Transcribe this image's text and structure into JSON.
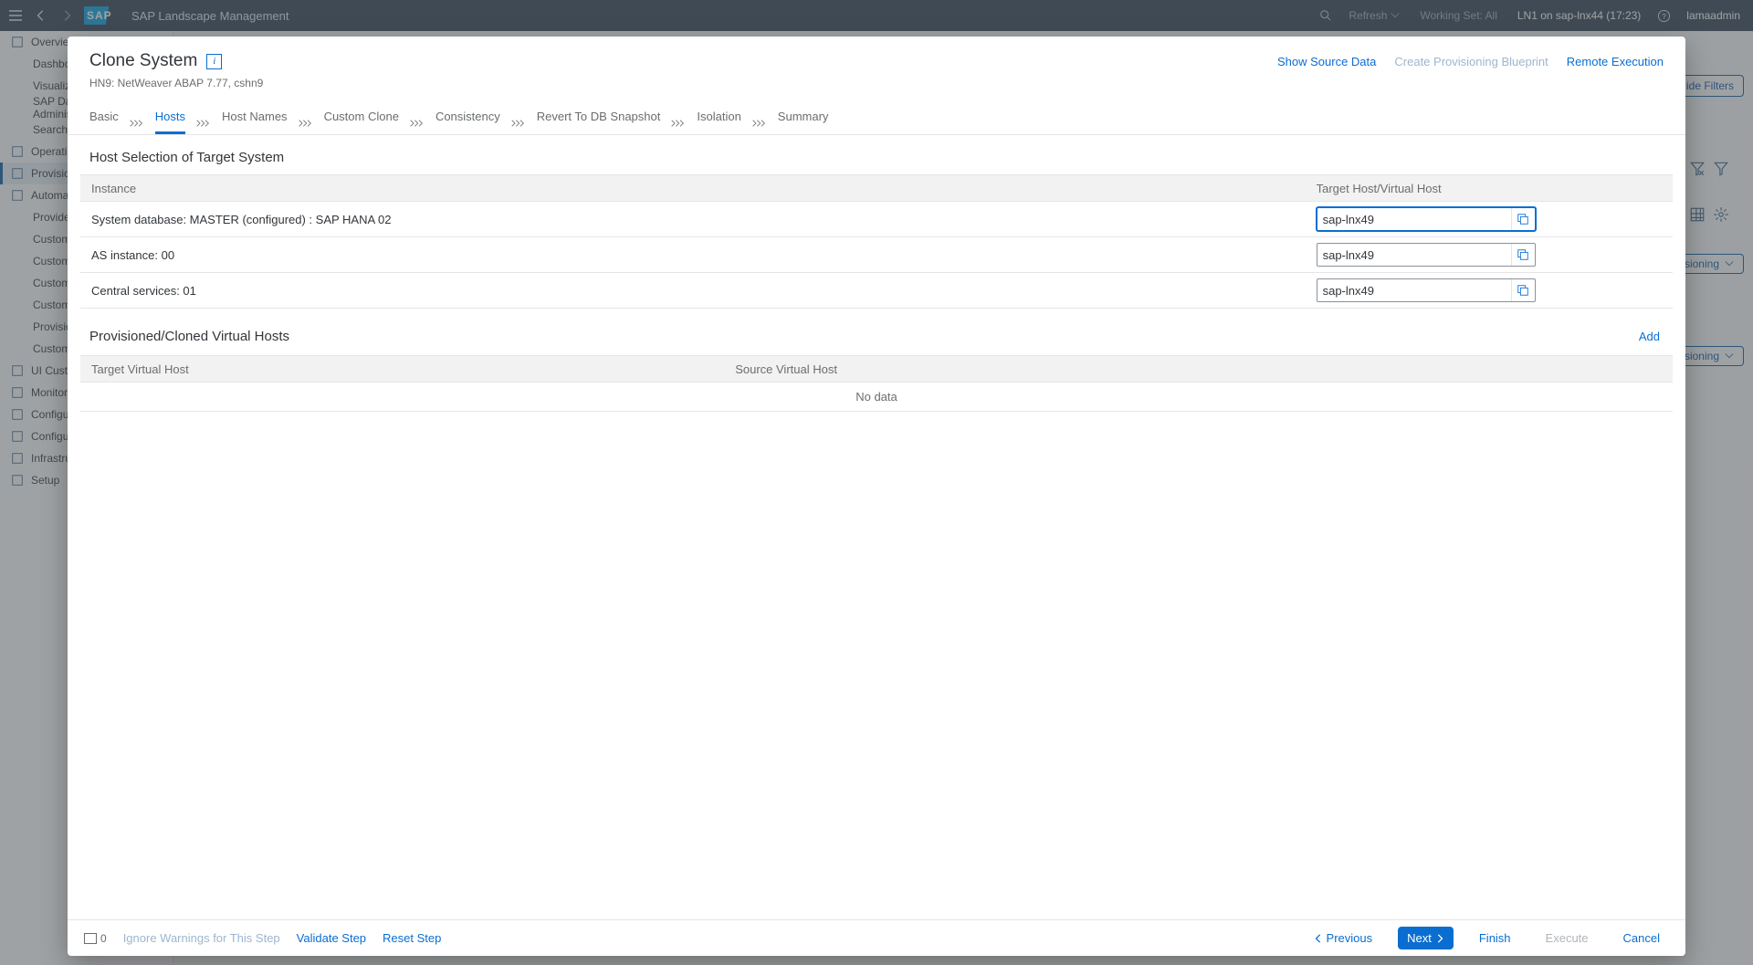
{
  "shell": {
    "app_title": "SAP Landscape Management",
    "brand": "SAP",
    "refresh": "Refresh",
    "working_set": "Working Set: All",
    "system_info": "LN1 on sap-lnx44 (17:23)",
    "user": "lamaadmin"
  },
  "nav": {
    "items": [
      {
        "label": "Overview",
        "icon": true
      },
      {
        "label": "Dashboard",
        "sub": true
      },
      {
        "label": "Visualization",
        "sub": true
      },
      {
        "label": "SAP Database Administration",
        "sub": true
      },
      {
        "label": "Search",
        "sub": true
      },
      {
        "label": "Operations",
        "icon": true
      },
      {
        "label": "Provisioning",
        "icon": true,
        "selected": true
      },
      {
        "label": "Automation Studio",
        "icon": true
      },
      {
        "label": "Provider Definitions",
        "sub": true
      },
      {
        "label": "Custom Operations",
        "sub": true
      },
      {
        "label": "Custom Hooks",
        "sub": true
      },
      {
        "label": "Custom Processes",
        "sub": true
      },
      {
        "label": "Custom Notifications",
        "sub": true
      },
      {
        "label": "Provisioning Blueprints",
        "sub": true
      },
      {
        "label": "Custom Provisioning",
        "sub": true
      },
      {
        "label": "UI Customizations",
        "icon": true
      },
      {
        "label": "Monitoring",
        "icon": true
      },
      {
        "label": "Configuration",
        "icon": true
      },
      {
        "label": "Configuration Extensions",
        "icon": true
      },
      {
        "label": "Infrastructure",
        "icon": true
      },
      {
        "label": "Setup",
        "icon": true
      }
    ]
  },
  "bg": {
    "hide_filters": "Hide Filters",
    "chip1": "Provisioning",
    "chip2": "Provisioning"
  },
  "dialog": {
    "title": "Clone System",
    "subtitle": "HN9: NetWeaver ABAP 7.77, cshn9",
    "actions": {
      "show_source": "Show Source Data",
      "blueprint": "Create Provisioning Blueprint",
      "remote": "Remote Execution"
    },
    "steps": [
      "Basic",
      "Hosts",
      "Host Names",
      "Custom Clone",
      "Consistency",
      "Revert To DB Snapshot",
      "Isolation",
      "Summary"
    ],
    "active_step": "Hosts",
    "section1_title": "Host Selection of Target System",
    "section1_cols": {
      "c1": "Instance",
      "c2": "Target Host/Virtual Host"
    },
    "section1_rows": [
      {
        "instance": "System database: MASTER (configured) : SAP HANA 02",
        "host": "sap-lnx49",
        "focus": true
      },
      {
        "instance": "AS instance: 00",
        "host": "sap-lnx49"
      },
      {
        "instance": "Central services: 01",
        "host": "sap-lnx49"
      }
    ],
    "section2_title": "Provisioned/Cloned Virtual Hosts",
    "section2_cols": {
      "c1": "Target Virtual Host",
      "c2": "Source Virtual Host"
    },
    "section2_nodata": "No data",
    "add_label": "Add"
  },
  "footer": {
    "msg_count": "0",
    "ignore": "Ignore Warnings for This Step",
    "validate": "Validate Step",
    "reset": "Reset Step",
    "previous": "Previous",
    "next": "Next",
    "finish": "Finish",
    "execute": "Execute",
    "cancel": "Cancel"
  }
}
